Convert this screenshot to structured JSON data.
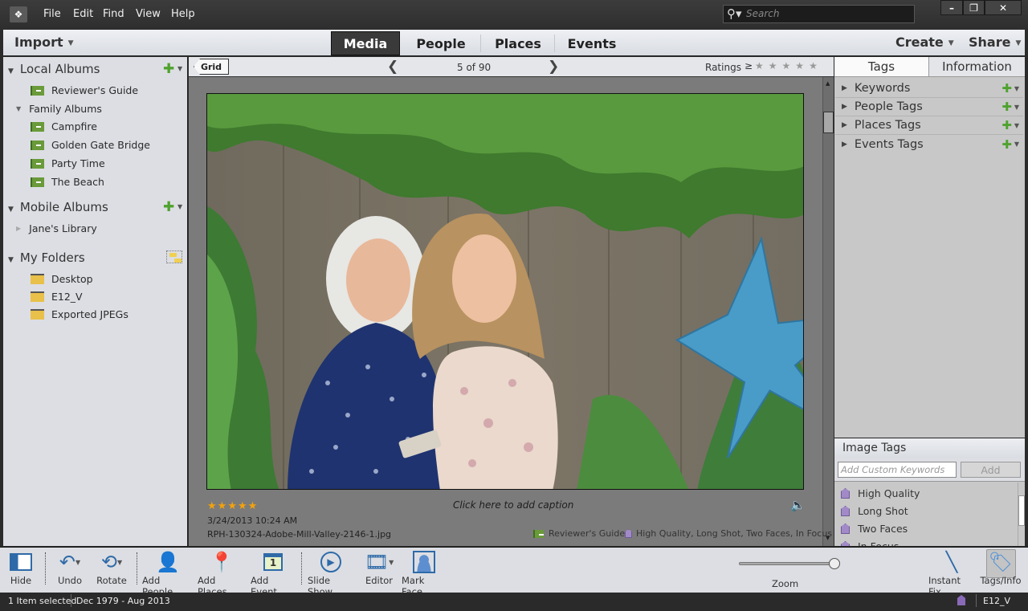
{
  "app": {
    "menu": [
      "File",
      "Edit",
      "Find",
      "View",
      "Help"
    ],
    "search_placeholder": "Search",
    "window_controls": {
      "minimize": "–",
      "restore": "❐",
      "close": "✕"
    }
  },
  "nav": {
    "import_label": "Import",
    "tabs": [
      {
        "label": "Media",
        "active": true
      },
      {
        "label": "People",
        "active": false
      },
      {
        "label": "Places",
        "active": false
      },
      {
        "label": "Events",
        "active": false
      }
    ],
    "create_label": "Create",
    "share_label": "Share"
  },
  "sidebar": {
    "local_albums": {
      "title": "Local Albums",
      "items": [
        "Reviewer's Guide"
      ],
      "group": {
        "title": "Family Albums",
        "items": [
          "Campfire",
          "Golden Gate Bridge",
          "Party Time",
          "The Beach"
        ]
      }
    },
    "mobile_albums": {
      "title": "Mobile Albums",
      "items": [
        "Jane's Library"
      ]
    },
    "my_folders": {
      "title": "My Folders",
      "items": [
        "Desktop",
        "E12_V",
        "Exported JPEGs"
      ]
    }
  },
  "viewer": {
    "grid_label": "Grid",
    "position": "5 of 90",
    "ratings_label": "Ratings",
    "ratings_op": "≥",
    "rating_filter_stars": 5,
    "photo": {
      "rating": 5,
      "date": "3/24/2013 10:24 AM",
      "filename": "RPH-130324-Adobe-Mill-Valley-2146-1.jpg",
      "caption_placeholder": "Click here to add caption",
      "album": "Reviewer's Guide",
      "tags": "High Quality, Long Shot, Two Faces, In Focus"
    }
  },
  "right_panel": {
    "tabs": [
      {
        "label": "Tags",
        "active": true
      },
      {
        "label": "Information",
        "active": false
      }
    ],
    "tag_sections": [
      "Keywords",
      "People Tags",
      "Places Tags",
      "Events Tags"
    ],
    "image_tags": {
      "title": "Image Tags",
      "input_placeholder": "Add Custom Keywords",
      "add_label": "Add",
      "items": [
        "High Quality",
        "Long Shot",
        "Two Faces",
        "In Focus"
      ]
    }
  },
  "toolbar": {
    "hide": "Hide",
    "undo": "Undo",
    "rotate": "Rotate",
    "add_people": "Add People",
    "add_places": "Add Places",
    "add_event": "Add Event",
    "slide_show": "Slide Show",
    "editor": "Editor",
    "mark_face": "Mark Face",
    "zoom": "Zoom",
    "instant_fix": "Instant Fix",
    "tags_info": "Tags/Info",
    "zoom_level": 1.0
  },
  "status": {
    "selection": "1 Item selected",
    "date_range": "Dec 1979 - Aug 2013",
    "catalog": "E12_V"
  },
  "colors": {
    "accent_green": "#4fa22e",
    "tag_purple": "#a28ac8",
    "star_gold": "#f2a20c",
    "icon_blue": "#2f6aa8"
  }
}
